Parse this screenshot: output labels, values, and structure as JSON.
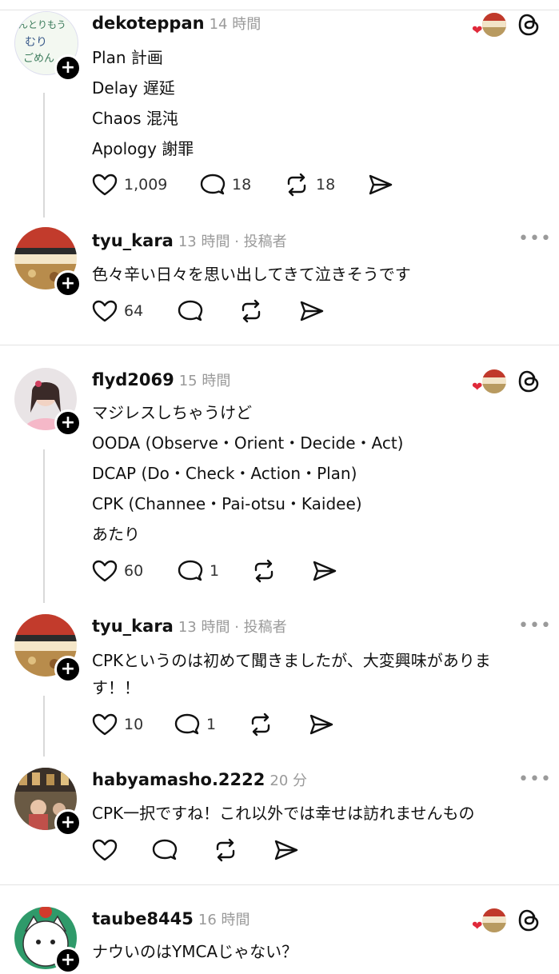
{
  "posts": [
    {
      "username": "dekoteppan",
      "time": "14 時間",
      "lines": [
        "Plan  計画",
        "Delay  遅延",
        "Chaos  混沌",
        "Apology 謝罪"
      ],
      "likes": "1,009",
      "comments": "18",
      "reposts": "18",
      "avatar_text": [
        "んとりもう",
        "むり",
        "ごめん"
      ]
    },
    {
      "username": "tyu_kara",
      "time": "13 時間 · 投稿者",
      "lines": [
        "色々辛い日々を思い出してきて泣きそうです"
      ],
      "likes": "64",
      "comments": "",
      "reposts": ""
    },
    {
      "username": "flyd2069",
      "time": "15 時間",
      "lines": [
        "マジレスしちゃうけど",
        "OODA (Observe・Orient・Decide・Act)",
        "DCAP (Do・Check・Action・Plan)",
        "CPK (Channee・Pai-otsu・Kaidee)",
        "あたり"
      ],
      "likes": "60",
      "comments": "1",
      "reposts": ""
    },
    {
      "username": "tyu_kara",
      "time": "13 時間 · 投稿者",
      "lines": [
        "CPKというのは初めて聞きましたが、大変興味がありま",
        "す！！"
      ],
      "likes": "10",
      "comments": "1",
      "reposts": ""
    },
    {
      "username": "habyamasho.2222",
      "time": "20 分",
      "lines": [
        "CPK一択ですね！これ以外では幸せは訪れませんもの"
      ],
      "likes": "",
      "comments": "",
      "reposts": ""
    },
    {
      "username": "taube8445",
      "time": "16 時間",
      "lines": [
        "ナウいのはYMCAじゃない？"
      ],
      "likes": "",
      "comments": "",
      "reposts": ""
    }
  ],
  "icons": {
    "like": "heart-icon",
    "comment": "comment-icon",
    "repost": "repost-icon",
    "share": "share-icon",
    "threads": "threads-logo-icon",
    "more": "more-icon"
  },
  "colors": {
    "heart_badge": "#e0293a",
    "muted": "#9a9a9a",
    "separator": "#e3e3e3"
  }
}
